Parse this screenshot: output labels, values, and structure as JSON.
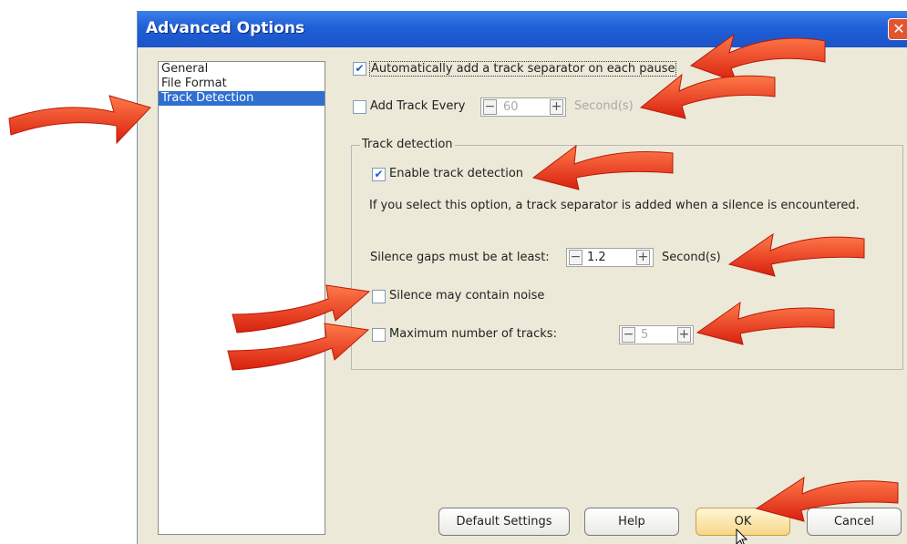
{
  "dialog": {
    "title": "Advanced Options",
    "close_glyph": "✕"
  },
  "nav": {
    "items": [
      {
        "label": "General",
        "selected": false
      },
      {
        "label": "File Format",
        "selected": false
      },
      {
        "label": "Track Detection",
        "selected": true
      }
    ]
  },
  "options": {
    "auto_separator": {
      "label": "Automatically add a track separator on each pause",
      "checked": true
    },
    "add_track_every": {
      "label": "Add Track Every",
      "checked": false,
      "value": "60",
      "unit": "Second(s)"
    }
  },
  "track_detection": {
    "group_title": "Track detection",
    "enable": {
      "label": "Enable track detection",
      "checked": true
    },
    "description": "If you select this option, a track separator is added when a silence is encountered.",
    "silence_gap": {
      "label": "Silence gaps must be at least:",
      "value": "1.2",
      "unit": "Second(s)"
    },
    "noise": {
      "label": "Silence may contain noise",
      "checked": false
    },
    "max_tracks": {
      "label": "Maximum number of tracks:",
      "checked": false,
      "value": "5"
    }
  },
  "buttons": {
    "default_settings": "Default Settings",
    "help": "Help",
    "ok": "OK",
    "cancel": "Cancel"
  },
  "icons": {
    "check": "✔",
    "minus": "−",
    "plus": "+"
  },
  "colors": {
    "titlebar": "#1f5fd8",
    "selection": "#2f6fd0",
    "annotation_arrow": "#e8381e"
  }
}
